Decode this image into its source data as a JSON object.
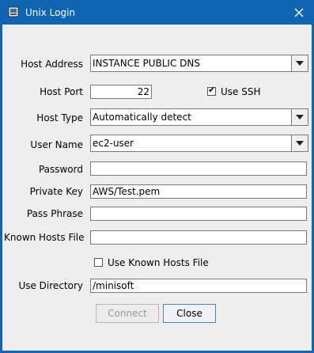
{
  "window": {
    "title": "Unix Login"
  },
  "form": {
    "host_address": {
      "label": "Host Address",
      "value": "INSTANCE PUBLIC DNS"
    },
    "host_port": {
      "label": "Host Port",
      "value": "22"
    },
    "use_ssh": {
      "label": "Use SSH",
      "checked": true
    },
    "host_type": {
      "label": "Host Type",
      "value": "Automatically detect"
    },
    "user_name": {
      "label": "User Name",
      "value": "ec2-user"
    },
    "password": {
      "label": "Password",
      "value": ""
    },
    "private_key": {
      "label": "Private Key",
      "value": "AWS/Test.pem"
    },
    "pass_phrase": {
      "label": "Pass Phrase",
      "value": ""
    },
    "known_hosts_file": {
      "label": "Known Hosts File",
      "value": ""
    },
    "use_known_hosts_file": {
      "label": "Use Known Hosts File",
      "checked": false
    },
    "use_directory": {
      "label": "Use Directory",
      "value": "/minisoft"
    }
  },
  "buttons": {
    "connect": "Connect",
    "close": "Close"
  }
}
